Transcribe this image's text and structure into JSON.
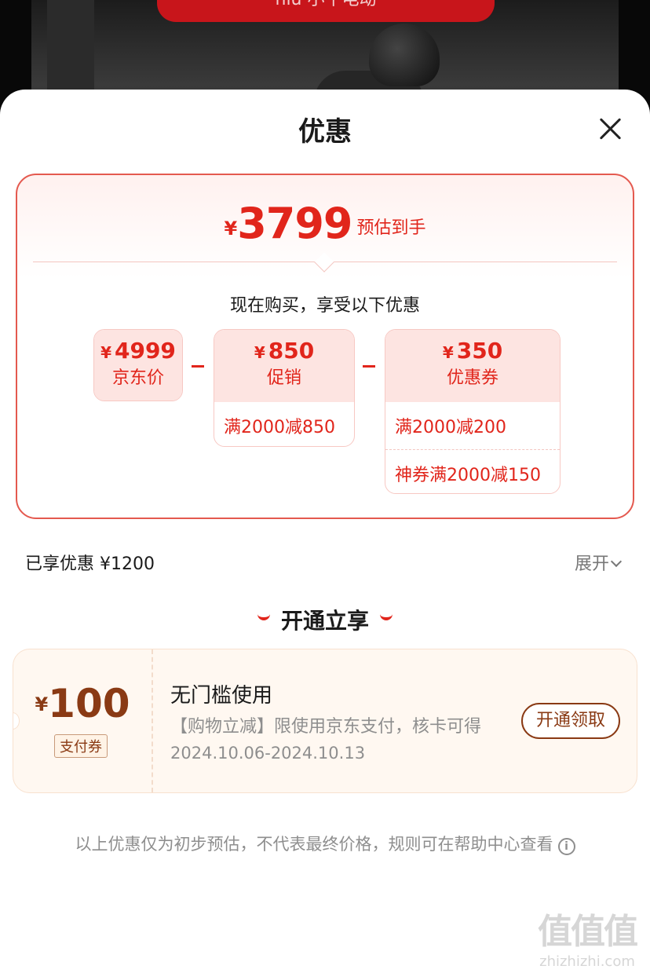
{
  "background": {
    "banner_text": "niu 小牛电动"
  },
  "sheet": {
    "title": "优惠"
  },
  "estimate": {
    "currency": "¥",
    "price": "3799",
    "label": "预估到手",
    "subtitle": "现在购买，享受以下优惠"
  },
  "breakdown": {
    "jd_price": {
      "currency": "¥",
      "amount": "4999",
      "name": "京东价"
    },
    "promo": {
      "currency": "¥",
      "amount": "850",
      "name": "促销",
      "rules": [
        "满2000减850"
      ]
    },
    "coupon": {
      "currency": "¥",
      "amount": "350",
      "name": "优惠券",
      "rules": [
        "满2000减200",
        "神券满2000减150"
      ]
    }
  },
  "summary": {
    "used_label": "已享优惠 ¥1200",
    "expand_label": "展开"
  },
  "open_section": {
    "title": "开通立享"
  },
  "pay_coupon": {
    "currency": "¥",
    "amount": "100",
    "type": "支付券",
    "title": "无门槛使用",
    "desc": "【购物立减】限使用京东支付，核卡可得",
    "validity": "2024.10.06-2024.10.13",
    "button": "开通领取"
  },
  "footnote": "以上优惠仅为初步预估，不代表最终价格，规则可在帮助中心查看",
  "watermark": {
    "main": "值值值",
    "sub": "zhizhizhi.com"
  },
  "colors": {
    "accent": "#e1251b",
    "coupon_brown": "#8a3a14",
    "muted": "#8e8e8e"
  }
}
